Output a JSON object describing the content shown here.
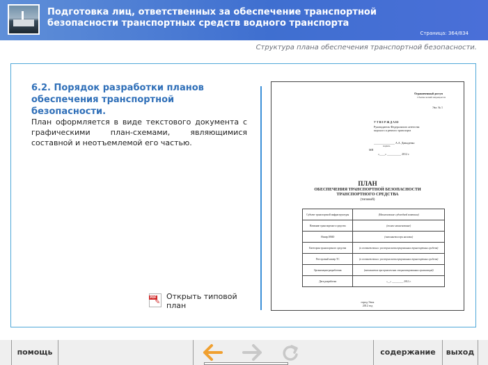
{
  "header": {
    "title_line1": "Подготовка лиц, ответственных за обеспечение транспортной",
    "title_line2": "безопасности транспортных средств водного транспорта",
    "page_counter": "Страница: 364/834"
  },
  "subtitle": "Структура плана обеспечения транспортной безопасности.",
  "content": {
    "heading": "6.2. Порядок разработки планов обеспечения транспортной безопасности.",
    "body": "План оформляется в виде текстового документа с графическими план-схемами, являющимися составной и неотъемлемой его частью.",
    "pdf_link": "Открыть типовой план",
    "pdf_icon": "pdf-file-icon",
    "pdf_band": "PDF"
  },
  "document_preview": {
    "restricted": "Ограниченный доступ",
    "restricted_sub": "Сбытие копий запрещается",
    "copy_no": "Экз. № 1",
    "approve": "У Т В Е Р Ж Д А Ю",
    "approve_org1": "Руководитель Федерального агентства",
    "approve_org2": "морского и речного транспорта",
    "signature_line": "_______________ А.А. Давыденко",
    "signature_hint": "подпись",
    "mp": "МП",
    "date_line": "«____» __________ 2012 г.",
    "plan_title": "ПЛАН",
    "plan_sub1": "ОБЕСПЕЧЕНИЯ ТРАНСПОРТНОЙ БЕЗОПАСНОСТИ",
    "plan_sub2": "ТРАНСПОРТНОГО СРЕДСТВА",
    "plan_sub3": "(типовой)",
    "table": [
      [
        "Субъект транспортной инфраструктуры",
        "(Наименование судоходной компании)"
      ],
      [
        "Название транспортного средства",
        "(полное наименование)"
      ],
      [
        "Номер ИМО",
        "(заполняется при наличии)"
      ],
      [
        "Категория транспортного средства",
        "(в соответствии с реестром категорированных транспортных средств)"
      ],
      [
        "Реестровый номер ТС",
        "(в соответствии с реестром категорированных транспортных средств)"
      ],
      [
        "Организация-разработчик",
        "(заполняется при привлечении специализированных организаций)"
      ],
      [
        "Дата разработки",
        "«__» _________ 2012 г."
      ]
    ],
    "city": "город Энск",
    "year": "2012 год"
  },
  "toolbar": {
    "help": "помощь",
    "contents": "содержание",
    "exit": "выход",
    "back_icon": "arrow-left-icon",
    "forward_icon": "arrow-right-icon",
    "reload_icon": "reload-icon",
    "accent": "#f0a030"
  }
}
